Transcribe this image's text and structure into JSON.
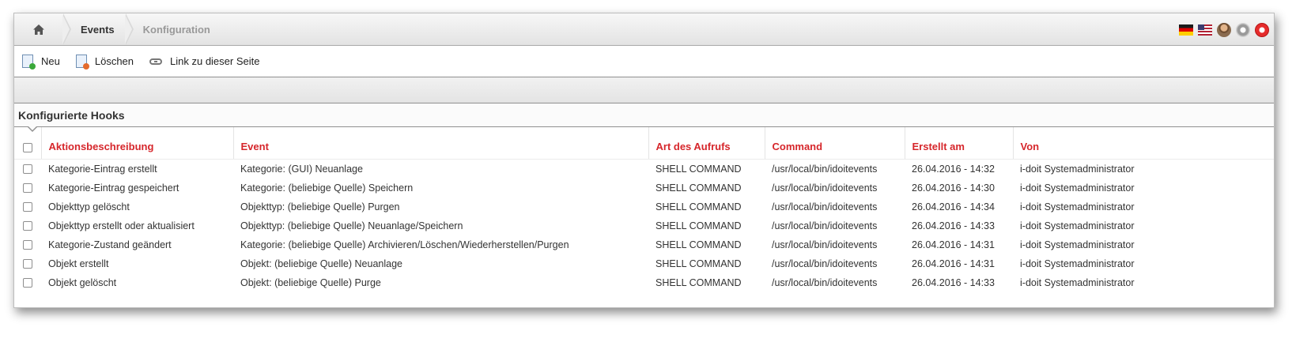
{
  "breadcrumb": {
    "events_label": "Events",
    "config_label": "Konfiguration"
  },
  "top_icons": [
    "flag-de-icon",
    "flag-us-icon",
    "user-icon",
    "gear-icon",
    "power-icon"
  ],
  "toolbar": {
    "new_label": "Neu",
    "delete_label": "Löschen",
    "link_label": "Link zu dieser Seite"
  },
  "section": {
    "title": "Konfigurierte Hooks"
  },
  "table": {
    "headers": {
      "description": "Aktionsbeschreibung",
      "event": "Event",
      "call_type": "Art des Aufrufs",
      "command": "Command",
      "created": "Erstellt am",
      "by": "Von"
    },
    "rows": [
      {
        "description": "Kategorie-Eintrag erstellt",
        "event": "Kategorie: (GUI) Neuanlage",
        "call_type": "SHELL COMMAND",
        "command": "/usr/local/bin/idoitevents",
        "created": "26.04.2016 - 14:32",
        "by": "i-doit Systemadministrator"
      },
      {
        "description": "Kategorie-Eintrag gespeichert",
        "event": "Kategorie: (beliebige Quelle) Speichern",
        "call_type": "SHELL COMMAND",
        "command": "/usr/local/bin/idoitevents",
        "created": "26.04.2016 - 14:30",
        "by": "i-doit Systemadministrator"
      },
      {
        "description": "Objekttyp gelöscht",
        "event": "Objekttyp: (beliebige Quelle) Purgen",
        "call_type": "SHELL COMMAND",
        "command": "/usr/local/bin/idoitevents",
        "created": "26.04.2016 - 14:34",
        "by": "i-doit Systemadministrator"
      },
      {
        "description": "Objekttyp erstellt oder aktualisiert",
        "event": "Objekttyp: (beliebige Quelle) Neuanlage/Speichern",
        "call_type": "SHELL COMMAND",
        "command": "/usr/local/bin/idoitevents",
        "created": "26.04.2016 - 14:33",
        "by": "i-doit Systemadministrator"
      },
      {
        "description": "Kategorie-Zustand geändert",
        "event": "Kategorie: (beliebige Quelle) Archivieren/Löschen/Wiederherstellen/Purgen",
        "call_type": "SHELL COMMAND",
        "command": "/usr/local/bin/idoitevents",
        "created": "26.04.2016 - 14:31",
        "by": "i-doit Systemadministrator"
      },
      {
        "description": "Objekt erstellt",
        "event": "Objekt: (beliebige Quelle) Neuanlage",
        "call_type": "SHELL COMMAND",
        "command": "/usr/local/bin/idoitevents",
        "created": "26.04.2016 - 14:31",
        "by": "i-doit Systemadministrator"
      },
      {
        "description": "Objekt gelöscht",
        "event": "Objekt: (beliebige Quelle) Purge",
        "call_type": "SHELL COMMAND",
        "command": "/usr/local/bin/idoitevents",
        "created": "26.04.2016 - 14:33",
        "by": "i-doit Systemadministrator"
      }
    ]
  }
}
